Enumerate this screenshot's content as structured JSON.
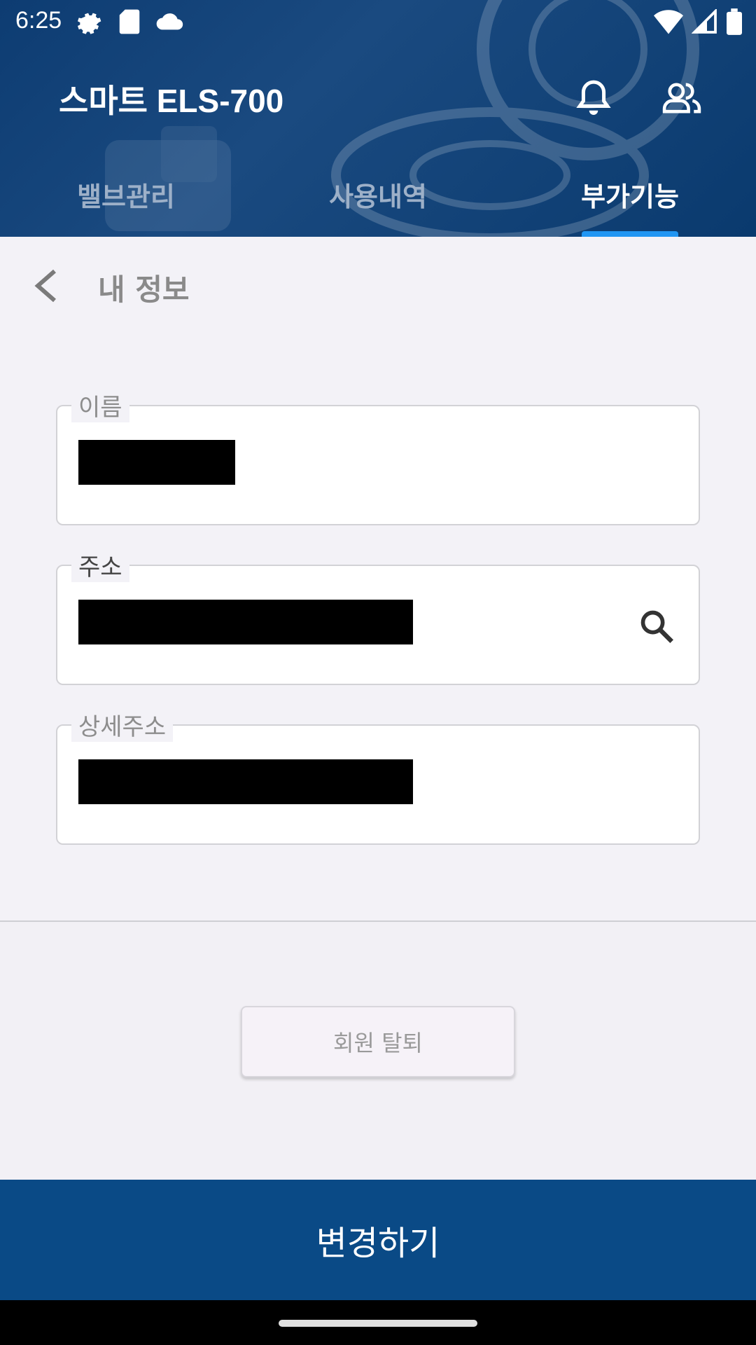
{
  "status_bar": {
    "time": "6:25",
    "icons_left": [
      "settings-icon",
      "sd-card-icon",
      "cloud-icon"
    ],
    "icons_right": [
      "wifi-icon",
      "signal-icon",
      "battery-icon"
    ]
  },
  "header": {
    "title": "스마트 ELS-700",
    "actions": [
      "bell-icon",
      "people-icon"
    ]
  },
  "tabs": [
    {
      "label": "밸브관리",
      "active": false
    },
    {
      "label": "사용내역",
      "active": false
    },
    {
      "label": "부가기능",
      "active": true
    }
  ],
  "colors": {
    "header_bg": "#0d3c72",
    "tab_indicator": "#2196f3",
    "submit_bg": "#0a4a86"
  },
  "page": {
    "title": "내 정보"
  },
  "form": {
    "name": {
      "label": "이름",
      "value_redacted": true
    },
    "address": {
      "label": "주소",
      "value_redacted": true
    },
    "address_detail": {
      "label": "상세주소",
      "value_redacted": true
    }
  },
  "withdraw_button": "회원 탈퇴",
  "submit_button": "변경하기"
}
